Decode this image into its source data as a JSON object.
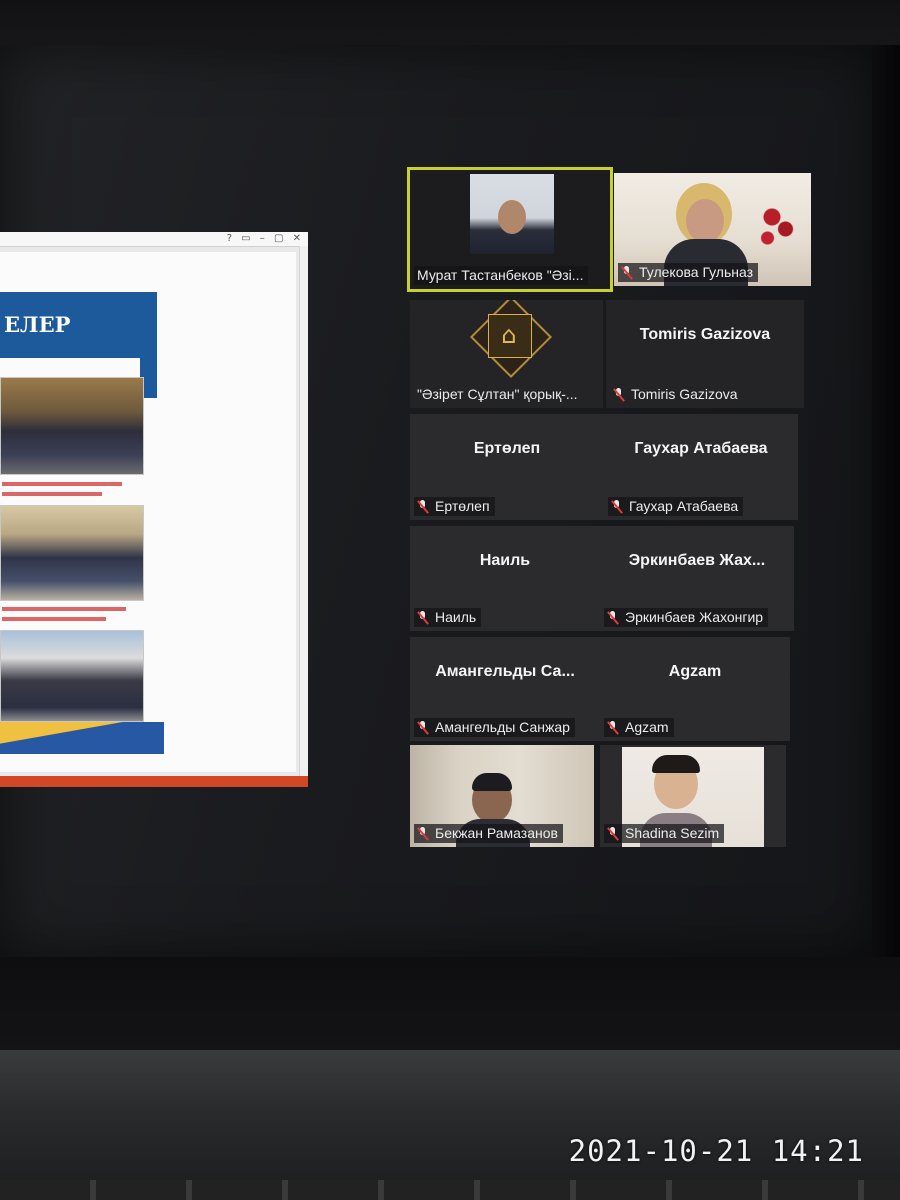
{
  "photo_timestamp": "2021-10-21 14:21",
  "shared_screen": {
    "slide_heading": "ЕЛЕР"
  },
  "participants": [
    {
      "name": "Мурат Тастанбеков \"Әзі...",
      "center_label": "",
      "video": true,
      "muted": false,
      "active_speaker": true
    },
    {
      "name": "Тулекова Гульназ",
      "center_label": "",
      "video": true,
      "muted": true,
      "active_speaker": false
    },
    {
      "name": "\"Әзірет Сұлтан\" қорық-...",
      "center_label": "",
      "video": false,
      "muted": false,
      "active_speaker": false,
      "logo": "mausoleum-logo"
    },
    {
      "name": "Tomiris Gazizova",
      "center_label": "Tomiris Gazizova",
      "video": false,
      "muted": true,
      "active_speaker": false
    },
    {
      "name": "Ертөлеп",
      "center_label": "Ертөлеп",
      "video": false,
      "muted": true,
      "active_speaker": false
    },
    {
      "name": "Гаухар Атабаева",
      "center_label": "Гаухар Атабаева",
      "video": false,
      "muted": true,
      "active_speaker": false
    },
    {
      "name": "Наиль",
      "center_label": "Наиль",
      "video": false,
      "muted": true,
      "active_speaker": false
    },
    {
      "name": "Эркинбаев Жахонгир",
      "center_label": "Эркинбаев Жах...",
      "video": false,
      "muted": true,
      "active_speaker": false
    },
    {
      "name": "Амангельды Санжар",
      "center_label": "Амангельды Са...",
      "video": false,
      "muted": true,
      "active_speaker": false
    },
    {
      "name": "Agzam",
      "center_label": "Agzam",
      "video": false,
      "muted": true,
      "active_speaker": false
    },
    {
      "name": "Бекжан Рамазанов",
      "center_label": "",
      "video": true,
      "muted": true,
      "active_speaker": false
    },
    {
      "name": "Shadina Sezim",
      "center_label": "",
      "video": true,
      "muted": true,
      "active_speaker": false
    }
  ],
  "colors": {
    "active_speaker_border": "#c8d12a",
    "muted_icon": "#e03a3a",
    "tile_background": "#2b2b2d"
  }
}
